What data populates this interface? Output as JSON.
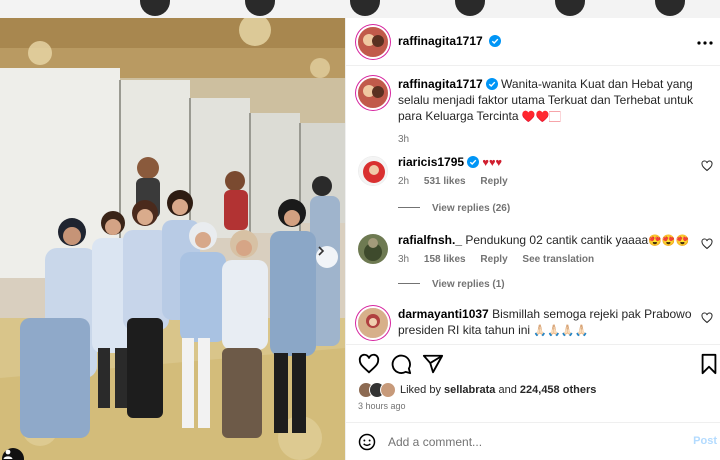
{
  "post": {
    "author": "raffinagita1717",
    "caption_author": "raffinagita1717",
    "caption": "Wanita-wanita Kuat dan Hebat yang selalu menjadi faktor utama Terkuat dan Terhebat untuk para Keluarga Tercinta",
    "caption_emojis": "♥️♥️🏻",
    "caption_time": "3h"
  },
  "comments": [
    {
      "username": "riaricis1795",
      "text": "",
      "emojis": "♥♥♥",
      "time": "2h",
      "likes": "531 likes",
      "reply_label": "Reply",
      "translate_label": "",
      "view_replies": "View replies (26)"
    },
    {
      "username": "rafialfnsh._",
      "text": "Pendukung 02 cantik cantik yaaaa",
      "emojis": "😍😍😍",
      "time": "3h",
      "likes": "158 likes",
      "reply_label": "Reply",
      "translate_label": "See translation",
      "view_replies": "View replies (1)"
    },
    {
      "username": "darmayanti1037",
      "text": "Bismillah semoga rejeki pak Prabowo presiden RI kita tahun ini",
      "emojis": "🙏🏻🙏🏻🙏🏻🙏🏻",
      "time": "",
      "likes": "",
      "reply_label": "",
      "translate_label": "",
      "view_replies": ""
    }
  ],
  "engagement": {
    "liked_by_prefix": "Liked by",
    "liked_by_user": "sellabrata",
    "liked_by_and": "and",
    "liked_by_count": "224,458 others",
    "posted_time": "3 hours ago"
  },
  "composer": {
    "placeholder": "Add a comment...",
    "post_label": "Post"
  },
  "icons": {
    "more": "more-options-icon",
    "verified": "verified-badge-icon",
    "heart": "heart-icon",
    "comment": "comment-icon",
    "share": "share-icon",
    "save": "bookmark-icon",
    "emoji": "emoji-icon",
    "next": "chevron-right-icon",
    "tag": "user-tag-icon"
  },
  "colors": {
    "verified": "#0095f6",
    "post_button_disabled": "#b3dbff",
    "meta_text": "#737373",
    "heart_red": "#ed4956"
  }
}
